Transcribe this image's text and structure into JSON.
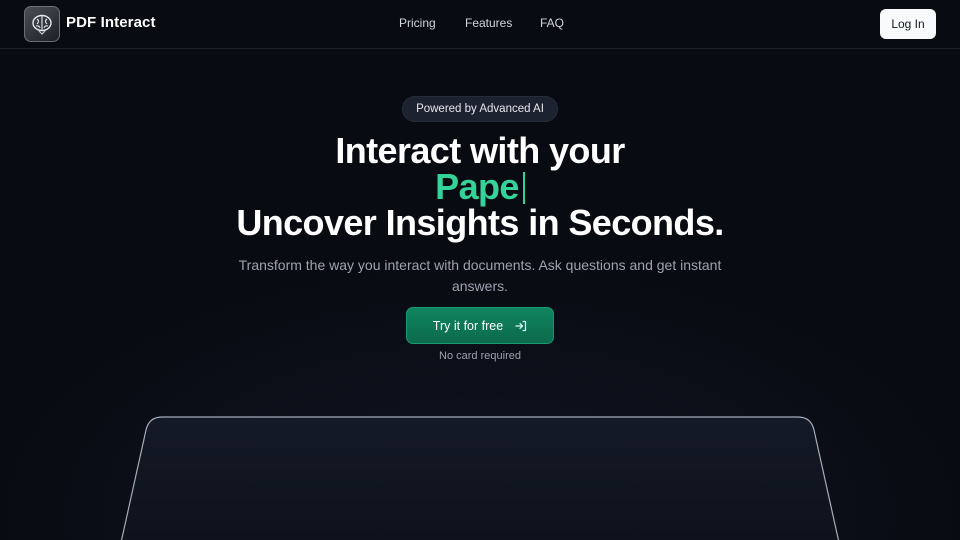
{
  "header": {
    "brand": "PDF Interact",
    "nav": [
      "Pricing",
      "Features",
      "FAQ"
    ],
    "login_label": "Log In"
  },
  "hero": {
    "badge": "Powered by Advanced AI",
    "headline_line1": "Interact with your",
    "headline_typed": "Pape",
    "headline_line3": "Uncover Insights in Seconds.",
    "subtitle": "Transform the way you interact with documents. Ask questions and get instant answers.",
    "cta_label": "Try it for free",
    "cta_note": "No card required"
  },
  "icons": {
    "logo": "brain-logo-icon",
    "cta": "sign-in-arrow-icon"
  },
  "colors": {
    "background": "#090b12",
    "accent": "#34d399",
    "cta": "#0b6b4c"
  }
}
